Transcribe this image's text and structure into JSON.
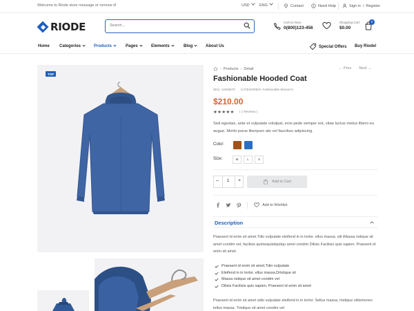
{
  "topbar": {
    "welcome": "Welcome to Riode store message or remove it!",
    "currency": "USD",
    "language": "ENG",
    "contact": "Contact",
    "need_help": "Need Help",
    "signin": "Sign in",
    "register": "Register",
    "separator": "/"
  },
  "header": {
    "logo": "RIODE",
    "search_placeholder": "Search...",
    "call_label": "Call Us Now:",
    "call_number": "0(800)123-456",
    "cart_label": "Shopping Cart:",
    "cart_amount": "$0.00",
    "cart_count": "0"
  },
  "nav": {
    "items": [
      "Home",
      "Categories",
      "Products",
      "Pages",
      "Elements",
      "Blog",
      "About Us"
    ],
    "active": "Products",
    "special_offers": "Special Offers",
    "buy": "Buy Riode!"
  },
  "gallery": {
    "badge": "TOP"
  },
  "product": {
    "breadcrumb": [
      "Products",
      "Detail"
    ],
    "prev": "← Prev",
    "next": "Next →",
    "title": "Fashionable Hooded Coat",
    "sku": "SKU: 12345670",
    "categories": "CATEGORIES: Fashionable Women's",
    "price": "$210.00",
    "stars": "★★★★★",
    "rating": 4,
    "reviews": "( 1 Reviews )",
    "short_desc": "Sed egestas, ante et vulputate volutpat, eros pede semper est, vitae luctus metus libero eu augue. Morbi purus liberpuro ate vol faucibus adipiscing.",
    "color_label": "Color:",
    "colors": [
      "#a0521d",
      "#2a6fc3"
    ],
    "size_label": "Size:",
    "sizes": [
      "M",
      "L",
      "S"
    ],
    "qty_minus": "–",
    "qty": "1",
    "qty_plus": "+",
    "add_to_cart": "Add to Cart",
    "add_to_wishlist": "Add to Wishlist",
    "description_title": "Description",
    "desc_para1": "Praesent id enim sit amet.Tdio vulputate eleifend in in tortor. ellus massa. siti iMassa ristique sit amet condim vel, facilisis quimequistiqutiqu amet condim Dilisis Facilisis quis sapien. Praesent id enim sit amet.",
    "bullets": [
      "Praesent id enim sit amet.Tdio vulputate",
      "Eleifend in in tortor. ellus massa.Dristique sit",
      "Massa ristique sit amet condim vel",
      "Dilisis Facilisis quis sapien. Praesent id enim sit amet"
    ],
    "desc_para2": "Praesent id enim sit amet odio vulputate eleifend in in tortor. Sellus massa, tristique sitiismonec tellus massa. Tristique sit amet condim vel"
  }
}
